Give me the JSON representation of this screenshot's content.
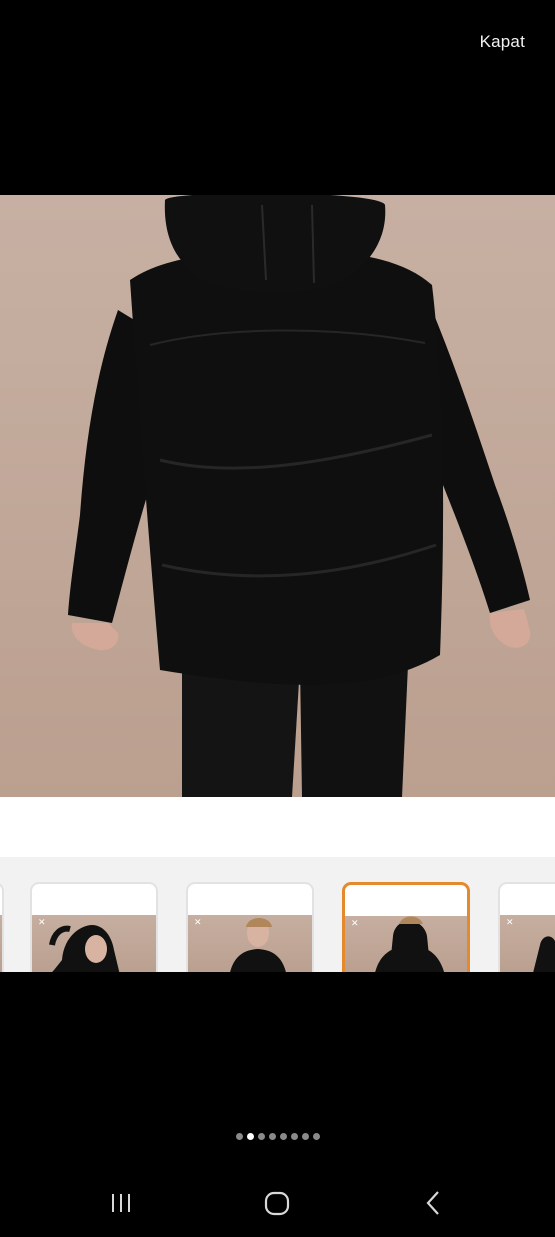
{
  "header": {
    "close_label": "Kapat"
  },
  "gallery": {
    "thumbnail_count": 5,
    "active_thumbnail": 3,
    "dot_count": 8,
    "active_dot": 2
  },
  "colors": {
    "background": "#000000",
    "photo_backdrop": "#c3ab9d",
    "active_border": "#e58a2c",
    "jacket": "#0d0d0d"
  },
  "system_nav": {
    "recents_icon": "recents-icon",
    "home_icon": "home-icon",
    "back_icon": "back-icon"
  }
}
